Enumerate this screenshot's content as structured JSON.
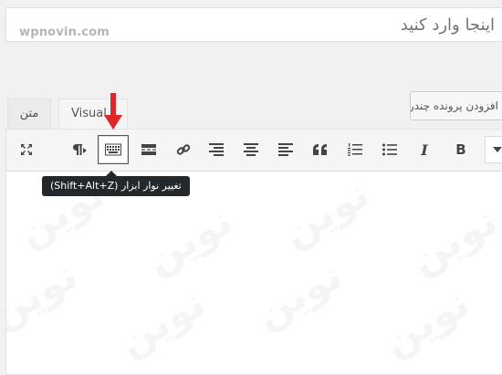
{
  "title": {
    "placeholder": "اینجا وارد کنید",
    "watermark": "wpnovin.com"
  },
  "media_button": {
    "label": "افزودن پرونده چندرسانه‌ای"
  },
  "tabs": {
    "text_label": "متن",
    "visual_label": "Visual"
  },
  "toolbar": {
    "bold_label": "B",
    "italic_label": "I",
    "buttons": [
      {
        "name": "fullscreen-icon"
      },
      {
        "name": "paragraph-icon"
      },
      {
        "name": "keyboard-icon"
      },
      {
        "name": "read-more-icon"
      },
      {
        "name": "link-icon"
      },
      {
        "name": "align-right-icon"
      },
      {
        "name": "align-center-icon"
      },
      {
        "name": "align-left-icon"
      },
      {
        "name": "blockquote-icon"
      },
      {
        "name": "numbered-list-icon"
      },
      {
        "name": "bullet-list-icon"
      },
      {
        "name": "italic-icon"
      },
      {
        "name": "bold-icon"
      },
      {
        "name": "chevron-down-icon"
      }
    ]
  },
  "tooltip": {
    "text": "تغییر نوار ابزار (Shift+Alt+Z)"
  },
  "editor": {
    "watermark_text": "نوین"
  },
  "colors": {
    "annotation_arrow": "#e02727",
    "tooltip_bg": "#23282d",
    "icon": "#444444"
  }
}
